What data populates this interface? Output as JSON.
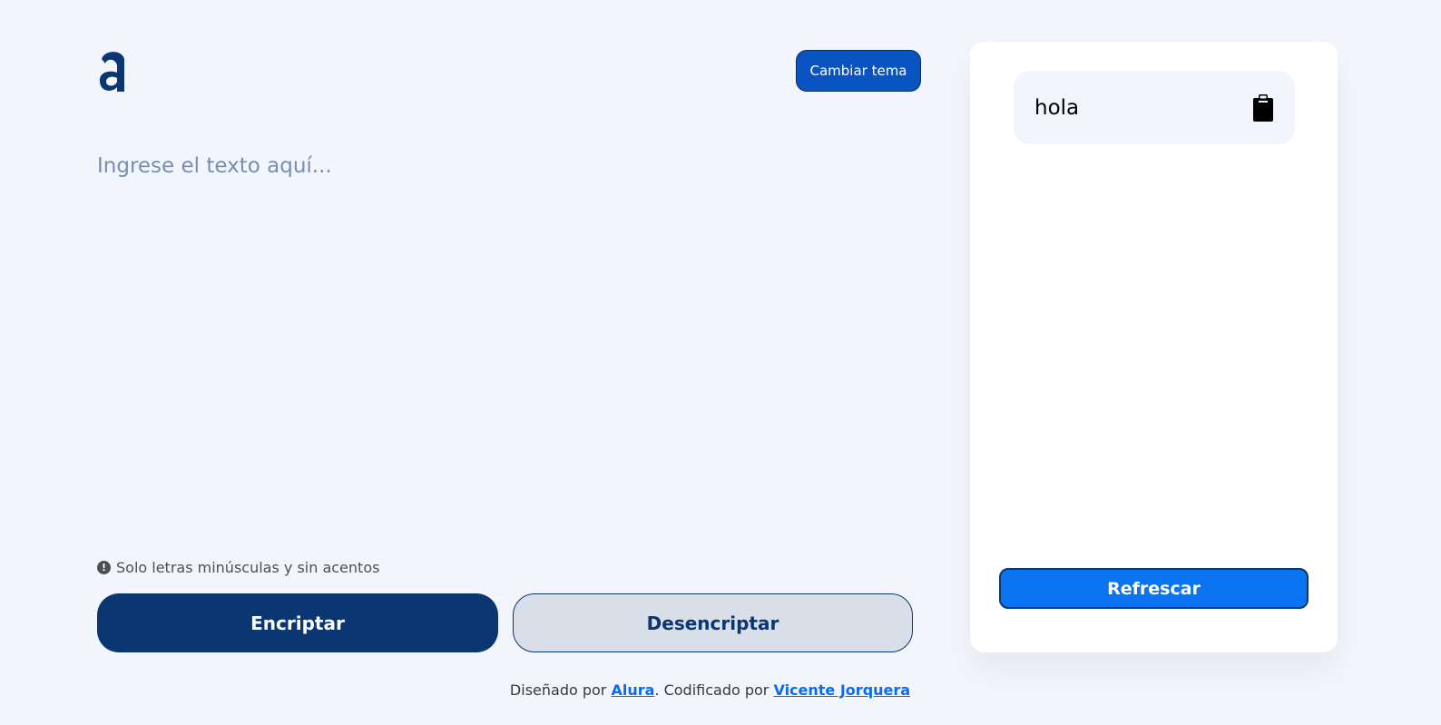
{
  "header": {
    "logo_icon": "alura-logo-icon",
    "theme_button_label": "Cambiar tema"
  },
  "editor": {
    "placeholder": "Ingrese el texto aquí...",
    "value": ""
  },
  "hint": {
    "icon": "exclamation-circle-icon",
    "text": "Solo letras minúsculas y sin acentos"
  },
  "actions": {
    "encrypt_label": "Encriptar",
    "decrypt_label": "Desencriptar"
  },
  "output_panel": {
    "result_text": "hola",
    "copy_icon": "clipboard-icon",
    "refresh_label": "Refrescar"
  },
  "footer": {
    "prefix": "Diseñado por ",
    "designer_link": "Alura",
    "middle": ". Codificado por ",
    "coder_link": "Vicente Jorquera"
  },
  "colors": {
    "background": "#f3f5fc",
    "primary_dark": "#0a3671",
    "accent_blue": "#0a73f0",
    "theme_button": "#0a54c2",
    "placeholder": "#7390b3"
  }
}
